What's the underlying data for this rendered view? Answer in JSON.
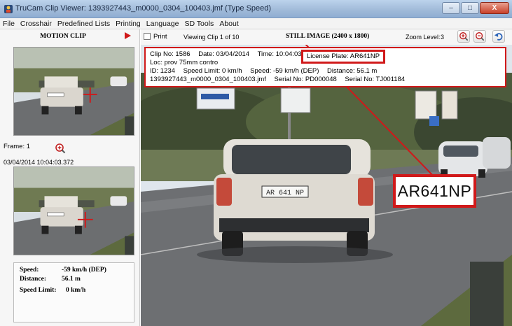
{
  "window": {
    "title": "TruCam Clip Viewer:  1393927443_m0000_0304_100403.jmf   (Type Speed)",
    "minimize": "–",
    "maximize": "□",
    "close": "X"
  },
  "menu": [
    "File",
    "Crosshair",
    "Predefined Lists",
    "Printing",
    "Language",
    "SD Tools",
    "About"
  ],
  "left_panel": {
    "title": "MOTION CLIP",
    "frame_label": "Frame: 1",
    "timestamp": "03/04/2014 10:04:03.372",
    "stats": {
      "speed_label": "Speed:",
      "speed_value": "-59 km/h (DEP)",
      "distance_label": "Distance:",
      "distance_value": "56.1 m",
      "limit_label": "Speed Limit:",
      "limit_value": "0 km/h"
    }
  },
  "toolbar": {
    "print_label": "Print",
    "viewing": "Viewing Clip 1 of 10",
    "still_title": "STILL IMAGE (2400 x 1800)",
    "zoom_label": "Zoom Level:",
    "zoom_value": "3"
  },
  "info": {
    "line1": {
      "clip": "Clip No: 1586",
      "date": "Date: 03/04/2014",
      "time": "Time: 10:04:03",
      "plate": "License Plate: AR641NP"
    },
    "line2": "Loc: prov 75mm contro",
    "line3": {
      "id": "ID: 1234",
      "limit": "Speed Limit: 0 km/h",
      "speed": "Speed: -59 km/h (DEP)",
      "distance": "Distance: 56.1 m"
    },
    "line4": {
      "file": "1393927443_m0000_0304_100403.jmf",
      "serial1": "Serial No: PD000048",
      "serial2": "Serial No: TJ001184"
    }
  },
  "plate_zoom": "AR641NP",
  "car_plate_text": "AR 641 NP",
  "colors": {
    "highlight_red": "#d0191a",
    "road": "#6d6f72",
    "sky": "#dfe6ec"
  }
}
